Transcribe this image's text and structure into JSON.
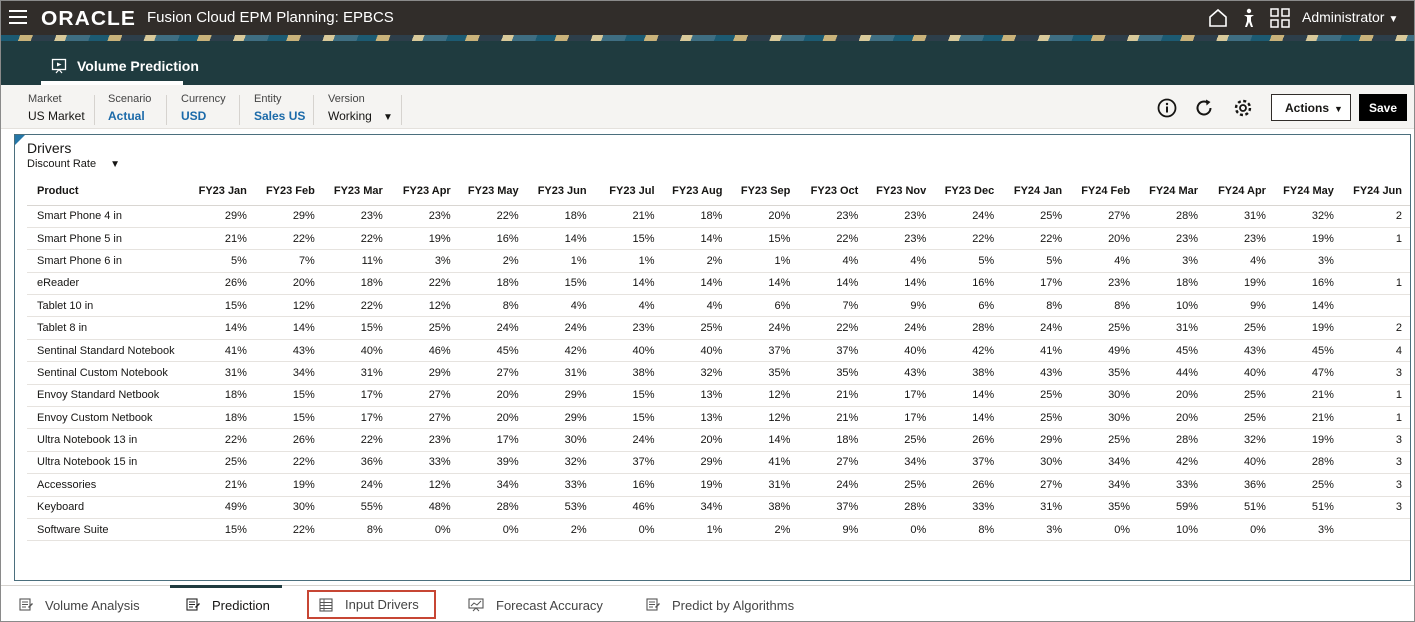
{
  "topbar": {
    "logo": "ORACLE",
    "app_title": "Fusion Cloud EPM Planning:  EPBCS",
    "user": "Administrator"
  },
  "page_tab": {
    "label": "Volume Prediction"
  },
  "pov": {
    "items": [
      {
        "label": "Market",
        "value": "US Market"
      },
      {
        "label": "Scenario",
        "value": "Actual"
      },
      {
        "label": "Currency",
        "value": "USD"
      },
      {
        "label": "Entity",
        "value": "Sales US"
      },
      {
        "label": "Version",
        "value": "Working"
      }
    ]
  },
  "toolbar": {
    "actions_label": "Actions",
    "save_label": "Save"
  },
  "panel": {
    "title": "Drivers",
    "measure": "Discount Rate"
  },
  "grid": {
    "product_header": "Product",
    "columns": [
      "FY23 Jan",
      "FY23 Feb",
      "FY23 Mar",
      "FY23 Apr",
      "FY23 May",
      "FY23 Jun",
      "FY23 Jul",
      "FY23 Aug",
      "FY23 Sep",
      "FY23 Oct",
      "FY23 Nov",
      "FY23 Dec",
      "FY24 Jan",
      "FY24 Feb",
      "FY24 Mar",
      "FY24 Apr",
      "FY24 May",
      "FY24 Jun"
    ],
    "rows": [
      {
        "product": "Smart Phone 4 in",
        "values": [
          "29%",
          "29%",
          "23%",
          "23%",
          "22%",
          "18%",
          "21%",
          "18%",
          "20%",
          "23%",
          "23%",
          "24%",
          "25%",
          "27%",
          "28%",
          "31%",
          "32%",
          "2"
        ]
      },
      {
        "product": "Smart Phone 5 in",
        "values": [
          "21%",
          "22%",
          "22%",
          "19%",
          "16%",
          "14%",
          "15%",
          "14%",
          "15%",
          "22%",
          "23%",
          "22%",
          "22%",
          "20%",
          "23%",
          "23%",
          "19%",
          "1"
        ]
      },
      {
        "product": "Smart Phone 6 in",
        "values": [
          "5%",
          "7%",
          "11%",
          "3%",
          "2%",
          "1%",
          "1%",
          "2%",
          "1%",
          "4%",
          "4%",
          "5%",
          "5%",
          "4%",
          "3%",
          "4%",
          "3%",
          ""
        ]
      },
      {
        "product": "eReader",
        "values": [
          "26%",
          "20%",
          "18%",
          "22%",
          "18%",
          "15%",
          "14%",
          "14%",
          "14%",
          "14%",
          "14%",
          "16%",
          "17%",
          "23%",
          "18%",
          "19%",
          "16%",
          "1"
        ]
      },
      {
        "product": "Tablet 10 in",
        "values": [
          "15%",
          "12%",
          "22%",
          "12%",
          "8%",
          "4%",
          "4%",
          "4%",
          "6%",
          "7%",
          "9%",
          "6%",
          "8%",
          "8%",
          "10%",
          "9%",
          "14%",
          ""
        ]
      },
      {
        "product": "Tablet 8 in",
        "values": [
          "14%",
          "14%",
          "15%",
          "25%",
          "24%",
          "24%",
          "23%",
          "25%",
          "24%",
          "22%",
          "24%",
          "28%",
          "24%",
          "25%",
          "31%",
          "25%",
          "19%",
          "2"
        ]
      },
      {
        "product": "Sentinal Standard Notebook",
        "values": [
          "41%",
          "43%",
          "40%",
          "46%",
          "45%",
          "42%",
          "40%",
          "40%",
          "37%",
          "37%",
          "40%",
          "42%",
          "41%",
          "49%",
          "45%",
          "43%",
          "45%",
          "4"
        ]
      },
      {
        "product": "Sentinal Custom Notebook",
        "values": [
          "31%",
          "34%",
          "31%",
          "29%",
          "27%",
          "31%",
          "38%",
          "32%",
          "35%",
          "35%",
          "43%",
          "38%",
          "43%",
          "35%",
          "44%",
          "40%",
          "47%",
          "3"
        ]
      },
      {
        "product": "Envoy Standard Netbook",
        "values": [
          "18%",
          "15%",
          "17%",
          "27%",
          "20%",
          "29%",
          "15%",
          "13%",
          "12%",
          "21%",
          "17%",
          "14%",
          "25%",
          "30%",
          "20%",
          "25%",
          "21%",
          "1"
        ]
      },
      {
        "product": "Envoy Custom Netbook",
        "values": [
          "18%",
          "15%",
          "17%",
          "27%",
          "20%",
          "29%",
          "15%",
          "13%",
          "12%",
          "21%",
          "17%",
          "14%",
          "25%",
          "30%",
          "20%",
          "25%",
          "21%",
          "1"
        ]
      },
      {
        "product": "Ultra Notebook 13 in",
        "values": [
          "22%",
          "26%",
          "22%",
          "23%",
          "17%",
          "30%",
          "24%",
          "20%",
          "14%",
          "18%",
          "25%",
          "26%",
          "29%",
          "25%",
          "28%",
          "32%",
          "19%",
          "3"
        ]
      },
      {
        "product": "Ultra Notebook 15 in",
        "values": [
          "25%",
          "22%",
          "36%",
          "33%",
          "39%",
          "32%",
          "37%",
          "29%",
          "41%",
          "27%",
          "34%",
          "37%",
          "30%",
          "34%",
          "42%",
          "40%",
          "28%",
          "3"
        ]
      },
      {
        "product": "Accessories",
        "values": [
          "21%",
          "19%",
          "24%",
          "12%",
          "34%",
          "33%",
          "16%",
          "19%",
          "31%",
          "24%",
          "25%",
          "26%",
          "27%",
          "34%",
          "33%",
          "36%",
          "25%",
          "3"
        ]
      },
      {
        "product": "Keyboard",
        "values": [
          "49%",
          "30%",
          "55%",
          "48%",
          "28%",
          "53%",
          "46%",
          "34%",
          "38%",
          "37%",
          "28%",
          "33%",
          "31%",
          "35%",
          "59%",
          "51%",
          "51%",
          "3"
        ]
      },
      {
        "product": "Software Suite",
        "values": [
          "15%",
          "22%",
          "8%",
          "0%",
          "0%",
          "2%",
          "0%",
          "1%",
          "2%",
          "9%",
          "0%",
          "8%",
          "3%",
          "0%",
          "10%",
          "0%",
          "3%",
          ""
        ]
      }
    ]
  },
  "bottom_tabs": [
    {
      "label": "Volume Analysis"
    },
    {
      "label": "Prediction"
    },
    {
      "label": "Input Drivers"
    },
    {
      "label": "Forecast Accuracy"
    },
    {
      "label": "Predict by Algorithms"
    }
  ],
  "colors": {
    "topbar": "#312d2a",
    "header": "#1f3b3f",
    "link": "#1b6aa9",
    "highlight": "#c74634"
  }
}
